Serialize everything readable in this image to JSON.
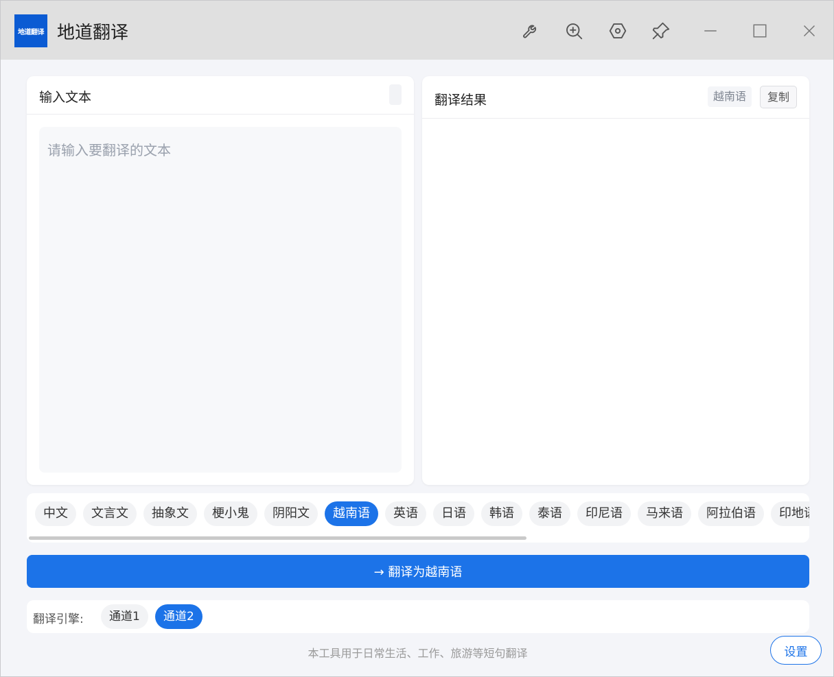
{
  "app": {
    "logo_text": "地道翻译",
    "title": "地道翻译"
  },
  "titlebar_icons": [
    "wrench-icon",
    "zoom-in-icon",
    "hexagon-settings-icon",
    "pin-icon",
    "minimize-icon",
    "maximize-icon",
    "close-icon"
  ],
  "input_panel": {
    "title": "输入文本",
    "placeholder": "请输入要翻译的文本"
  },
  "output_panel": {
    "title": "翻译结果",
    "target_lang": "越南语",
    "copy_label": "复制"
  },
  "languages": {
    "items": [
      "中文",
      "文言文",
      "抽象文",
      "梗小鬼",
      "阴阳文",
      "越南语",
      "英语",
      "日语",
      "韩语",
      "泰语",
      "印尼语",
      "马来语",
      "阿拉伯语",
      "印地语"
    ],
    "selected": "越南语"
  },
  "translate_button": "→ 翻译为越南语",
  "engine": {
    "label": "翻译引擎:",
    "options": [
      "通道1",
      "通道2"
    ],
    "selected": "通道2"
  },
  "footer": "本工具用于日常生活、工作、旅游等短句翻译",
  "settings_label": "设置",
  "colors": {
    "accent": "#1c73e8",
    "logo_bg": "#0b5bd3",
    "titlebar_bg": "#e0e0e0"
  }
}
